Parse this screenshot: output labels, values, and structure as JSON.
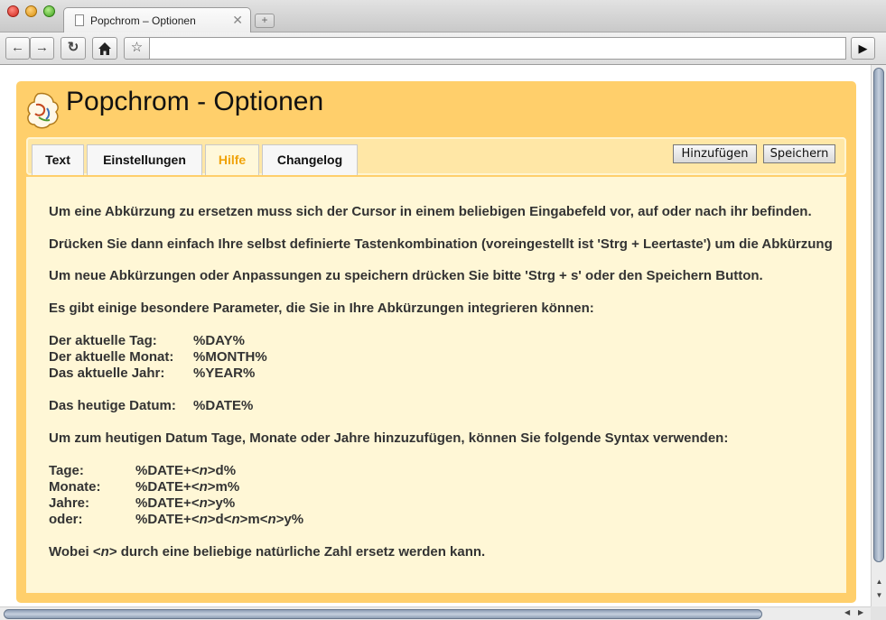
{
  "browser": {
    "tab_title": "Popchrom – Optionen",
    "new_tab_icon": "plus-icon",
    "toolbar_icons": [
      "back-arrow-icon",
      "forward-arrow-icon",
      "reload-icon",
      "home-icon",
      "star-icon",
      "go-icon"
    ],
    "address_value": ""
  },
  "page": {
    "title": "Popchrom - Optionen",
    "logo_icon": "popchrom-logo-icon",
    "tabs": [
      {
        "label": "Text"
      },
      {
        "label": "Einstellungen"
      },
      {
        "label": "Hilfe",
        "active": true
      },
      {
        "label": "Changelog"
      }
    ],
    "buttons": {
      "add_label": "Hinzufügen",
      "save_label": "Speichern"
    },
    "colors": {
      "frame": "#ffcf6b",
      "tabbar": "#ffe7a6",
      "content": "#fff7d6",
      "active_tab_text": "#f0a30a"
    }
  },
  "help": {
    "p1": "Um eine Abkürzung zu ersetzen muss sich der Cursor in einem beliebigen Eingabefeld vor, auf oder nach ihr befinden.",
    "p2": "Drücken Sie dann einfach Ihre selbst definierte Tastenkombination (voreingestellt ist 'Strg + Leertaste') um die Abkürzung",
    "p3": "Um neue Abkürzungen oder Anpassungen zu speichern drücken Sie bitte 'Strg + s' oder den Speichern Button.",
    "p4": "Es gibt einige besondere Parameter, die Sie in Ihre Abkürzungen integrieren können:",
    "params": [
      {
        "label": "Der aktuelle Tag:",
        "value": "%DAY%"
      },
      {
        "label": "Der aktuelle Monat:",
        "value": "%MONTH%"
      },
      {
        "label": "Das aktuelle Jahr:",
        "value": "%YEAR%"
      }
    ],
    "date_param": {
      "label": "Das heutige Datum:",
      "value": "%DATE%"
    },
    "p5": "Um zum heutigen Datum Tage, Monate oder Jahre hinzuzufügen, können Sie folgende Syntax verwenden:",
    "syntax": [
      {
        "label": "Tage:",
        "value": "%DATE+<n>d%"
      },
      {
        "label": "Monate:",
        "value": "%DATE+<n>m%"
      },
      {
        "label": "Jahre:",
        "value": "%DATE+<n>y%"
      },
      {
        "label": "oder:",
        "value": "%DATE+<n>d<n>m<n>y%"
      }
    ],
    "p6": "Wobei <n> durch eine beliebige natürliche Zahl ersetz werden kann."
  }
}
